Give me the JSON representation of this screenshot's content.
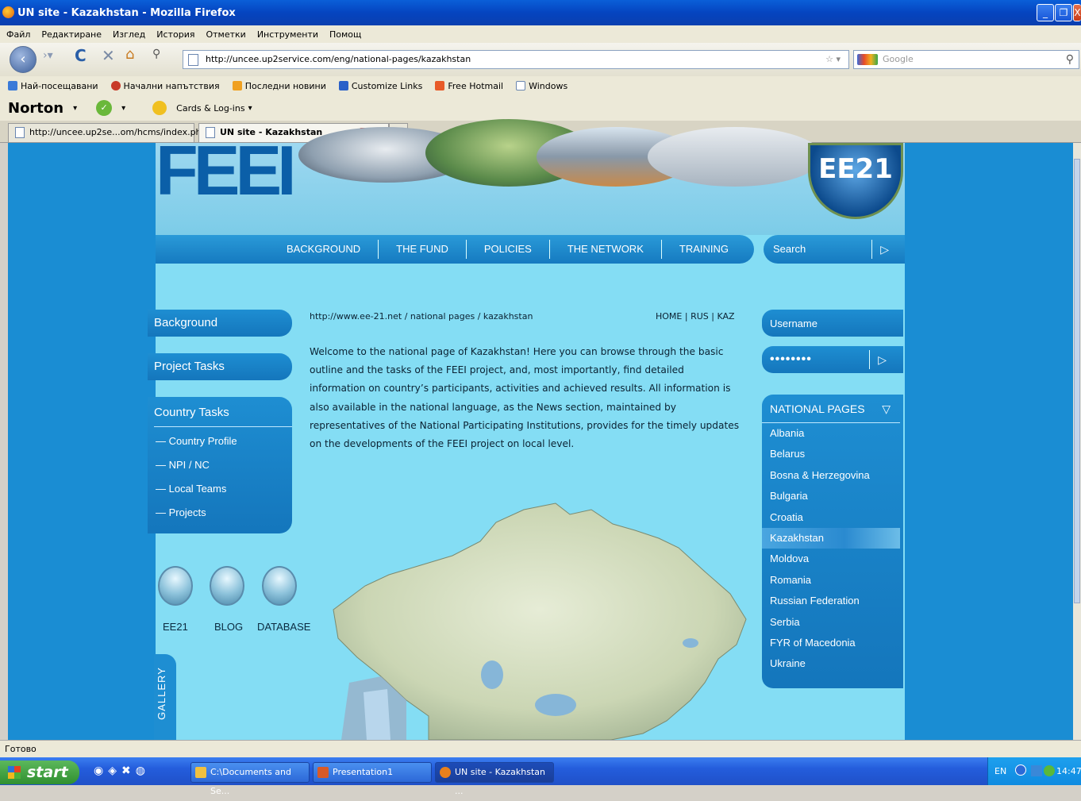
{
  "window": {
    "title": "UN site - Kazakhstan - Mozilla Firefox"
  },
  "menu": [
    "Файл",
    "Редактиране",
    "Изглед",
    "История",
    "Отметки",
    "Инструменти",
    "Помощ"
  ],
  "address": {
    "url": "http://uncee.up2service.com/eng/national-pages/kazakhstan",
    "search_placeholder": "Google"
  },
  "bookmarks": [
    {
      "label": "Най-посещавани",
      "color": "#3a7ad8"
    },
    {
      "label": "Начални напътствия",
      "color": "#c83a28"
    },
    {
      "label": "Последни новини",
      "color": "#f0a020"
    },
    {
      "label": "Customize Links",
      "color": "#2a60c8"
    },
    {
      "label": "Free Hotmail",
      "color": "#e85a28"
    },
    {
      "label": "Windows",
      "color": "#ffffff"
    }
  ],
  "norton": {
    "logo": "Norton",
    "cards": "Cards & Log-ins"
  },
  "tabs": [
    {
      "label": "http://uncee.up2se...om/hcms/index.php"
    },
    {
      "label": "UN site - Kazakhstan"
    }
  ],
  "site": {
    "logo": "FEEI",
    "badge": "EE21",
    "nav": [
      "BACKGROUND",
      "THE FUND",
      "POLICIES",
      "THE NETWORK",
      "TRAINING"
    ],
    "search_label": "Search",
    "left_menu": {
      "background": "Background",
      "project_tasks": "Project Tasks",
      "country_tasks": "Country Tasks",
      "sub": [
        "— Country Profile",
        "— NPI / NC",
        "— Local Teams",
        "— Projects"
      ]
    },
    "quick_links": [
      "EE21",
      "BLOG",
      "DATABASE"
    ],
    "gallery": "GALLERY",
    "breadcrumb": "http://www.ee-21.net / national pages / kazakhstan",
    "toplinks": "HOME | RUS | KAZ",
    "intro": "Welcome to the national page of Kazakhstan! Here you can browse through the basic outline and the tasks of the FEEI project, and, most importantly, find detailed information on country’s participants, activities and achieved results. All information is also available in the national language, as the News section, maintained by representatives of the National Participating Institutions, provides for the timely updates on the developments of the FEEI project on local level.",
    "login": {
      "username": "Username",
      "password": "••••••••"
    },
    "national_pages": {
      "title": "NATIONAL PAGES",
      "countries": [
        "Albania",
        "Belarus",
        "Bosna & Herzegovina",
        "Bulgaria",
        "Croatia",
        "Kazakhstan",
        "Moldova",
        "Romania",
        "Russian Federation",
        "Serbia",
        "FYR of Macedonia",
        "Ukraine"
      ],
      "active": "Kazakhstan"
    }
  },
  "status": "Готово",
  "taskbar": {
    "start": "start",
    "tasks": [
      {
        "label": "C:\\Documents and Se...",
        "color": "#f0c040"
      },
      {
        "label": "Presentation1",
        "color": "#d85a28"
      },
      {
        "label": "UN site - Kazakhstan ...",
        "color": "#e8801c"
      }
    ],
    "lang": "EN",
    "clock": "14:47"
  }
}
